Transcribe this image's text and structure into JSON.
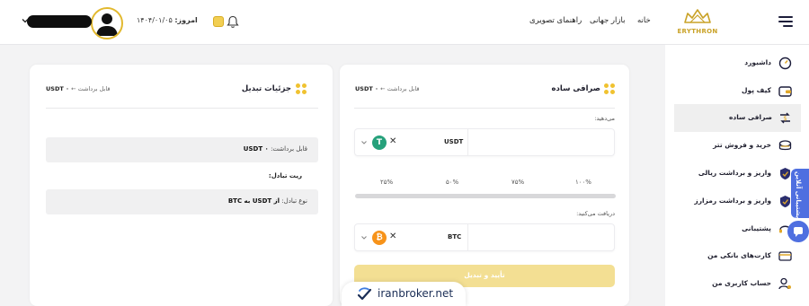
{
  "header": {
    "brand": "ERYTHRON",
    "nav": [
      "خانه",
      "بازار جهانی",
      "راهنمای تصویری"
    ],
    "date_label": "امروز:",
    "date_value": "۱۴۰۴/۰۱/۰۵"
  },
  "sidebar": {
    "items": [
      {
        "label": "داشبورد",
        "icon": "gauge-icon"
      },
      {
        "label": "کیف پول",
        "icon": "wallet-icon"
      },
      {
        "label": "صرافی ساده",
        "icon": "exchange-icon"
      },
      {
        "label": "خرید و فروش تتر",
        "icon": "tether-trade-icon"
      },
      {
        "label": "واریز و برداشت ریالی",
        "icon": "rial-transfer-icon"
      },
      {
        "label": "واریز و برداشت رمزارز",
        "icon": "crypto-transfer-icon"
      },
      {
        "label": "پشتیبانی",
        "icon": "support-icon"
      },
      {
        "label": "کارت‌های بانکی من",
        "icon": "bank-card-icon"
      },
      {
        "label": "حساب کاربری من",
        "icon": "user-settings-icon"
      }
    ],
    "active_index": 2,
    "support_tab": "پشتیبانی آنلاین"
  },
  "exchange_card": {
    "title": "صرافی ساده",
    "withdraw_label": "قابل برداشت",
    "withdraw_value": "USDT ۰",
    "give_label": "می‌دهید:",
    "give_currency": "USDT",
    "percents": [
      "۱۰۰%",
      "۷۵%",
      "۵۰%",
      "۲۵%"
    ],
    "receive_label": "دریافت می‌کنید:",
    "receive_currency": "BTC",
    "confirm_label": "تأیید و تبدیل"
  },
  "details_card": {
    "title": "جزئیات تبدیل",
    "withdraw_label": "قابل برداشت",
    "withdraw_value": "USDT ۰",
    "row1_label": "قابل برداشت:",
    "row1_value": "USDT ۰",
    "row2_label": "ریت تبادل:",
    "row3_label": "نوع تبادل:",
    "row3_value": "از USDT به BTC"
  },
  "watermark": "iranbroker.net",
  "colors": {
    "accent": "#f0c230",
    "tether": "#26a17b",
    "bitcoin": "#f7931a",
    "support_blue": "#4f6fe0"
  }
}
